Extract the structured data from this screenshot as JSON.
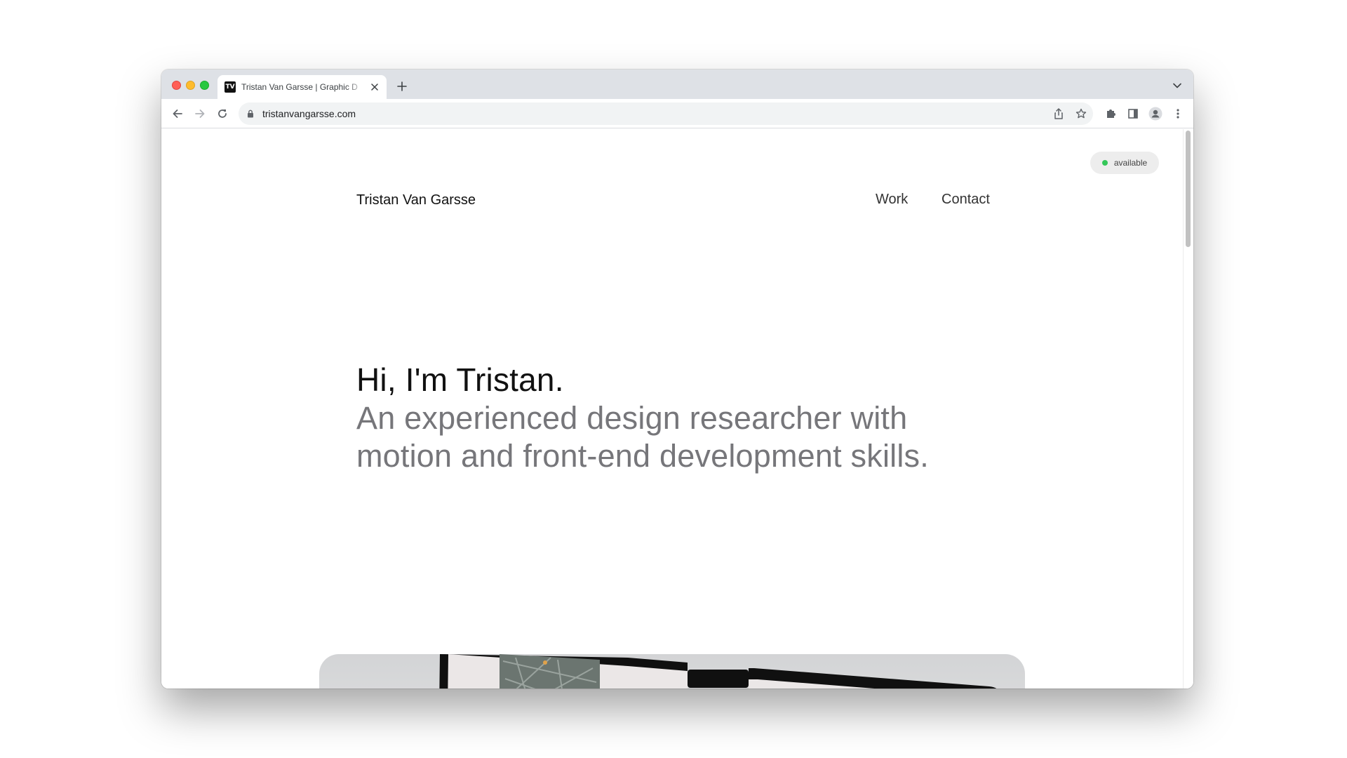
{
  "browser": {
    "tab_title": "Tristan Van Garsse | Graphic D",
    "favicon_text": "TV",
    "url": "tristanvangarsse.com"
  },
  "page": {
    "status_badge": "available",
    "site_name": "Tristan Van Garsse",
    "nav": [
      {
        "label": "Work"
      },
      {
        "label": "Contact"
      }
    ],
    "hero": {
      "greeting": "Hi, I'm Tristan.",
      "subtitle": "An experienced design researcher with motion and front-end development skills."
    }
  },
  "colors": {
    "status_dot": "#34c759",
    "subtitle": "#76767a",
    "titlebar": "#dee1e6"
  },
  "icons": [
    "close-icon",
    "plus-icon",
    "chevron-down-icon",
    "back-icon",
    "forward-icon",
    "reload-icon",
    "lock-icon",
    "share-icon",
    "star-icon",
    "puzzle-icon",
    "side-panel-icon",
    "profile-icon",
    "more-vert-icon"
  ]
}
